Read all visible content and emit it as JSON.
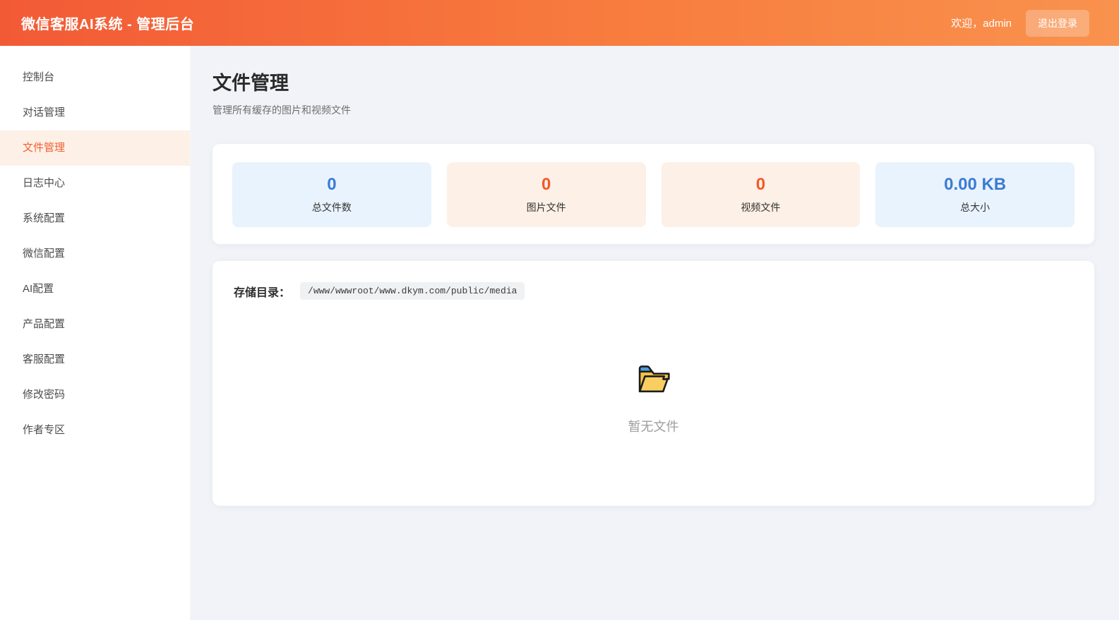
{
  "header": {
    "title": "微信客服AI系统 - 管理后台",
    "welcome": "欢迎，admin",
    "logout_label": "退出登录"
  },
  "sidebar": {
    "items": [
      {
        "label": "控制台",
        "active": false
      },
      {
        "label": "对话管理",
        "active": false
      },
      {
        "label": "文件管理",
        "active": true
      },
      {
        "label": "日志中心",
        "active": false
      },
      {
        "label": "系统配置",
        "active": false
      },
      {
        "label": "微信配置",
        "active": false
      },
      {
        "label": "AI配置",
        "active": false
      },
      {
        "label": "产品配置",
        "active": false
      },
      {
        "label": "客服配置",
        "active": false
      },
      {
        "label": "修改密码",
        "active": false
      },
      {
        "label": "作者专区",
        "active": false
      }
    ]
  },
  "page": {
    "title": "文件管理",
    "subtitle": "管理所有缓存的图片和视频文件"
  },
  "stats": {
    "cards": [
      {
        "value": "0",
        "label": "总文件数",
        "theme": "blue"
      },
      {
        "value": "0",
        "label": "图片文件",
        "theme": "orange"
      },
      {
        "value": "0",
        "label": "视频文件",
        "theme": "orange"
      },
      {
        "value": "0.00 KB",
        "label": "总大小",
        "theme": "blue"
      }
    ]
  },
  "storage": {
    "label": "存储目录：",
    "path": "/www/wwwroot/www.dkym.com/public/media"
  },
  "empty_state": {
    "icon": "open-folder-icon",
    "text": "暂无文件"
  },
  "colors": {
    "header_gradient_start": "#f25a36",
    "header_gradient_end": "#f9924e",
    "active_item_text": "#f4602f",
    "active_item_bg": "#fdf0e7",
    "value_blue": "#3a7bd5",
    "value_orange": "#f4582a",
    "card_blue_bg": "#e9f3fd",
    "card_orange_bg": "#fdf0e6",
    "content_bg": "#f1f3f8"
  }
}
